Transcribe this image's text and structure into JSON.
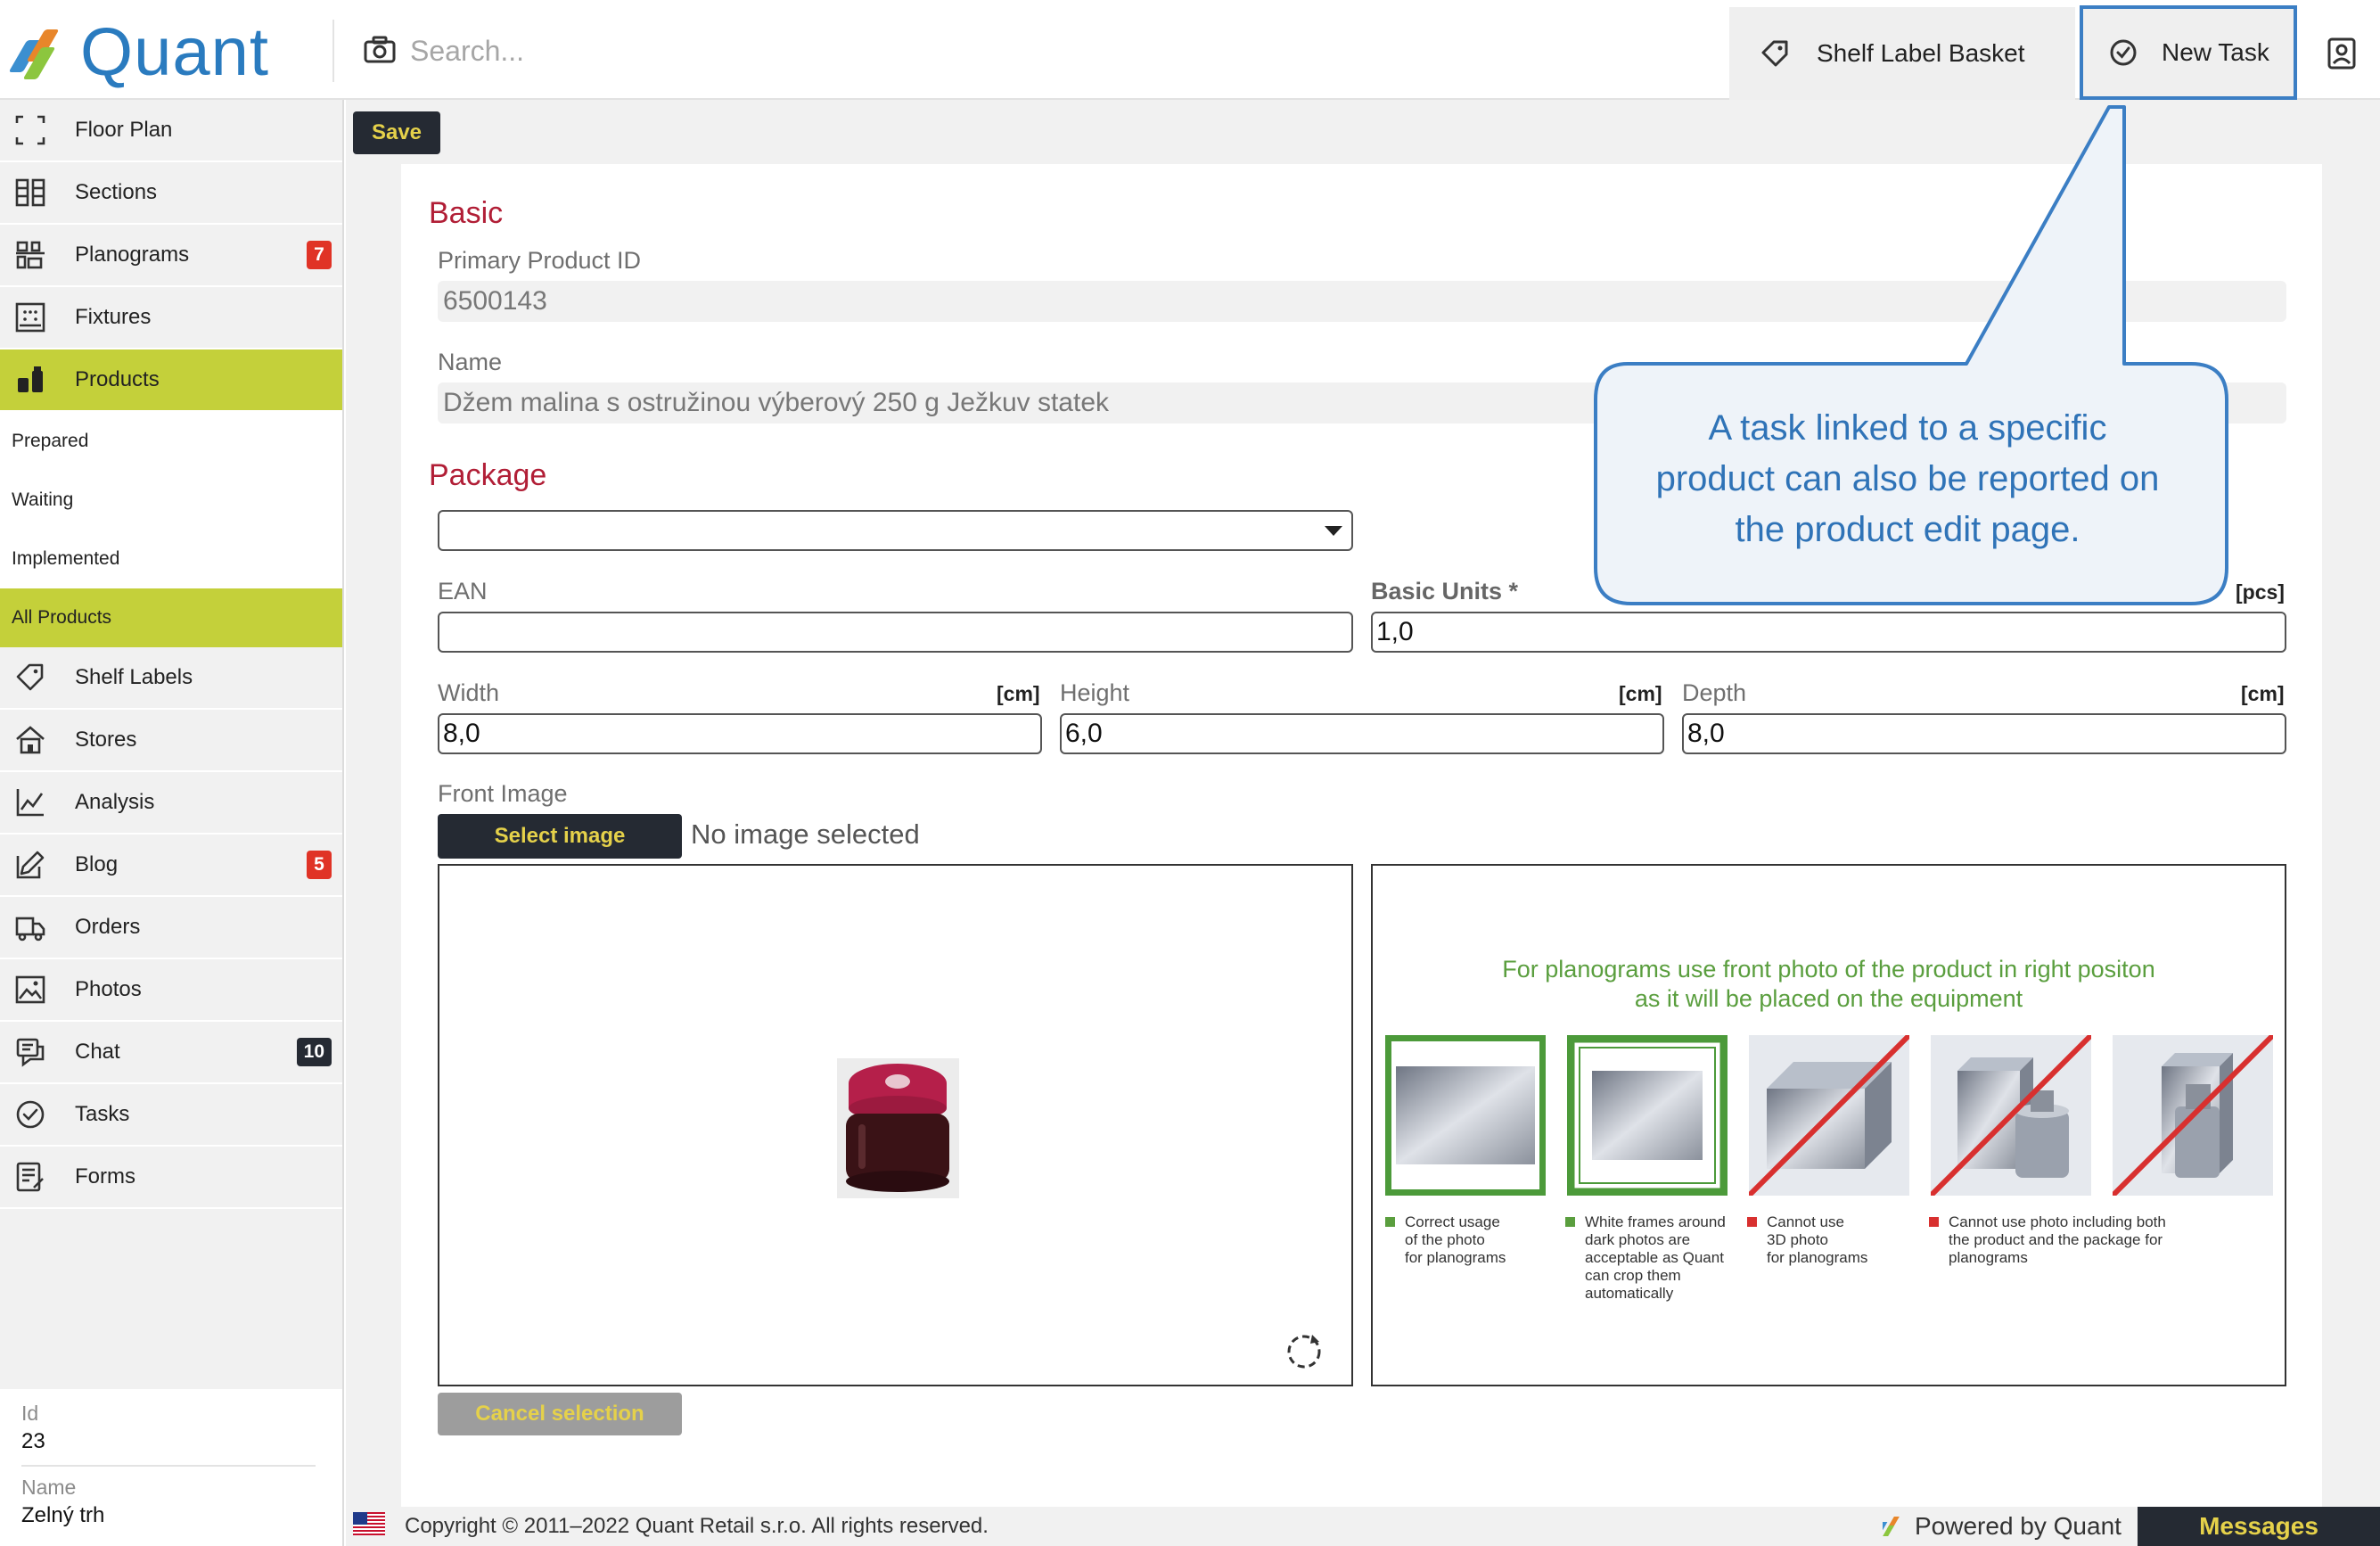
{
  "colors": {
    "accent_lime": "#c4d03a",
    "dark_button": "#252a33",
    "button_text": "#e5d14a",
    "section_red": "#b11e36",
    "brand_blue": "#2a7bbf",
    "badge_red": "#e03326",
    "badge_dark": "#252a33",
    "callout_blue": "#3b7ec4",
    "callout_fill": "#eef3f9",
    "guide_green": "#5a9e3e",
    "guide_red": "#d8302f"
  },
  "header": {
    "logo_text": "Quant",
    "search_placeholder": "Search...",
    "search_icon": "camera-icon",
    "shelf_label_basket": "Shelf Label Basket",
    "new_task": "New Task",
    "user_icon": "user-profile-icon"
  },
  "sidebar": {
    "items": [
      {
        "label": "Floor Plan",
        "icon": "floor-plan-icon"
      },
      {
        "label": "Sections",
        "icon": "sections-icon"
      },
      {
        "label": "Planograms",
        "icon": "planograms-icon",
        "badge": "7"
      },
      {
        "label": "Fixtures",
        "icon": "fixtures-icon"
      },
      {
        "label": "Products",
        "icon": "products-icon",
        "active": true
      }
    ],
    "sub_items": [
      {
        "label": "Prepared"
      },
      {
        "label": "Waiting"
      },
      {
        "label": "Implemented"
      },
      {
        "label": "All Products",
        "active": true
      }
    ],
    "items2": [
      {
        "label": "Shelf Labels",
        "icon": "tag-icon"
      },
      {
        "label": "Stores",
        "icon": "store-icon"
      },
      {
        "label": "Analysis",
        "icon": "chart-icon"
      },
      {
        "label": "Blog",
        "icon": "edit-icon",
        "badge": "5"
      },
      {
        "label": "Orders",
        "icon": "truck-icon"
      },
      {
        "label": "Photos",
        "icon": "photo-icon"
      },
      {
        "label": "Chat",
        "icon": "chat-icon",
        "badge": "10"
      },
      {
        "label": "Tasks",
        "icon": "check-circle-icon"
      },
      {
        "label": "Forms",
        "icon": "form-icon"
      }
    ],
    "info": {
      "id_label": "Id",
      "id_value": "23",
      "name_label": "Name",
      "name_value": "Zelný trh"
    }
  },
  "toolbar": {
    "save_label": "Save"
  },
  "form": {
    "basic_title": "Basic",
    "primary_id_label": "Primary Product ID",
    "primary_id_value": "6500143",
    "name_label": "Name",
    "name_value": "Džem malina s ostružinou výberový 250 g Ježkuv statek",
    "package_title": "Package",
    "package_selected": "",
    "ean_label": "EAN",
    "ean_value": "",
    "basic_units_label": "Basic Units *",
    "basic_units_unit": "[pcs]",
    "basic_units_value": "1,0",
    "width_label": "Width",
    "width_unit": "[cm]",
    "width_value": "8,0",
    "height_label": "Height",
    "height_unit": "[cm]",
    "height_value": "6,0",
    "depth_label": "Depth",
    "depth_unit": "[cm]",
    "depth_value": "8,0",
    "front_image_label": "Front Image",
    "select_image": "Select image",
    "no_image": "No image selected",
    "cancel_selection": "Cancel selection"
  },
  "guide": {
    "title_line1": "For planograms use front photo of the product in right positon",
    "title_line2": "as it will be placed on the equipment",
    "captions": [
      {
        "l1": "Correct usage",
        "l2": "of the photo",
        "l3": "for planograms",
        "l4": "",
        "l5": "",
        "ok": true
      },
      {
        "l1": "White frames around",
        "l2": "dark photos are",
        "l3": "acceptable as Quant",
        "l4": "can crop them",
        "l5": "automatically",
        "ok": true
      },
      {
        "l1": "Cannot use",
        "l2": "3D photo",
        "l3": "for planograms",
        "l4": "",
        "l5": "",
        "ok": false
      },
      {
        "l1": "Cannot use photo including both",
        "l2": "the product and the package for",
        "l3": "planograms",
        "l4": "",
        "l5": "",
        "ok": false
      }
    ]
  },
  "callout": {
    "line1": "A task linked to a specific",
    "line2": "product can also be reported on",
    "line3": "the product edit page."
  },
  "footer": {
    "copyright": "Copyright © 2011–2022 Quant Retail s.r.o. All rights reserved.",
    "powered": "Powered by Quant",
    "messages": "Messages"
  }
}
